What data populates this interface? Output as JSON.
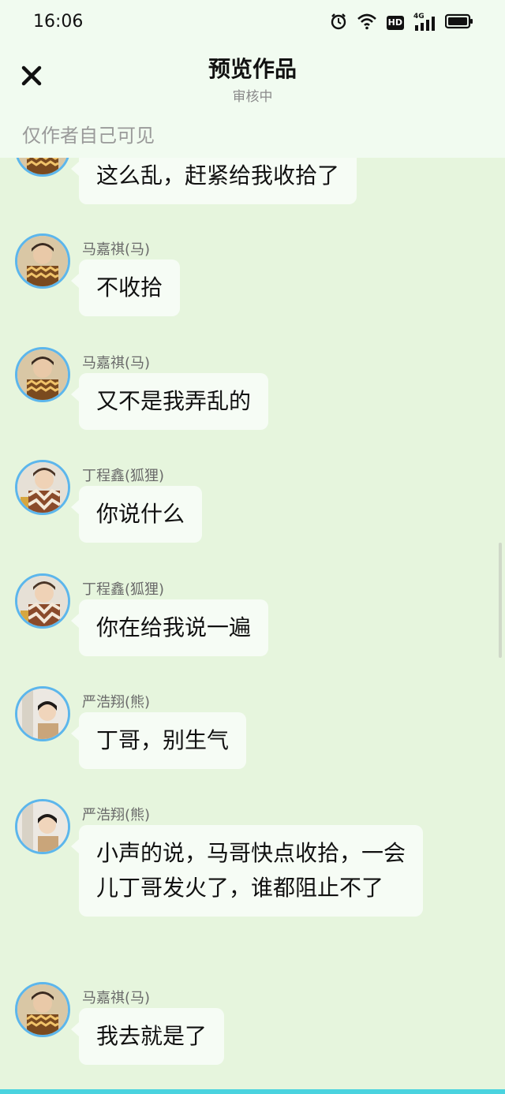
{
  "status": {
    "time": "16:06",
    "hd_label": "HD",
    "network_label": "4G"
  },
  "header": {
    "title": "预览作品",
    "subtitle": "审核中",
    "notice": "仅作者自己可见"
  },
  "colors": {
    "background": "#e6f5dd",
    "bubble": "#f6fcf5",
    "avatar_ring": "#5cb6ec",
    "accent_bar": "#4ad3df"
  },
  "messages": [
    {
      "name": "",
      "avatar": "ma-avatar",
      "text": "这么乱，赶紧给我收拾了"
    },
    {
      "name": "马嘉祺(马)",
      "avatar": "ma-avatar",
      "text": "不收拾"
    },
    {
      "name": "马嘉祺(马)",
      "avatar": "ma-avatar",
      "text": "又不是我弄乱的"
    },
    {
      "name": "丁程鑫(狐狸)",
      "avatar": "ding-avatar",
      "text": "你说什么"
    },
    {
      "name": "丁程鑫(狐狸)",
      "avatar": "ding-avatar",
      "text": "你在给我说一遍"
    },
    {
      "name": "严浩翔(熊)",
      "avatar": "yan-avatar",
      "text": "丁哥，别生气"
    },
    {
      "name": "严浩翔(熊)",
      "avatar": "yan-avatar",
      "text": "小声的说，马哥快点收拾，一会儿丁哥发火了，谁都阻止不了"
    },
    {
      "name": "马嘉祺(马)",
      "avatar": "ma-avatar",
      "text": "我去就是了"
    }
  ]
}
